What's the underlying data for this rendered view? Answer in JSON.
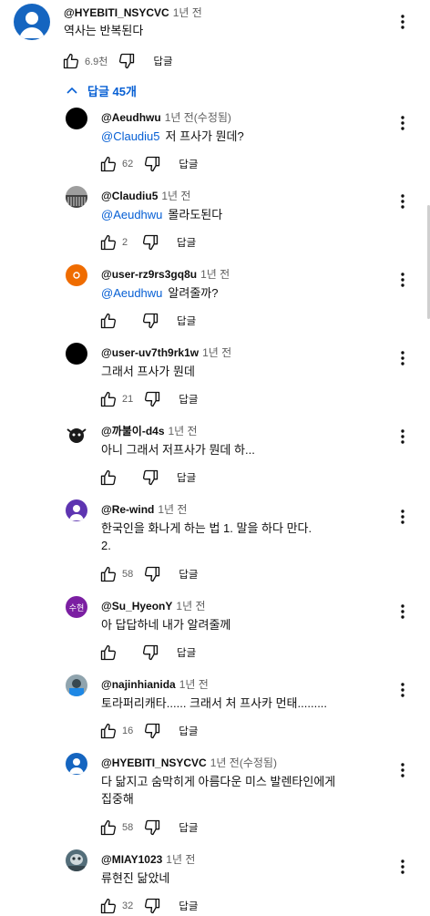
{
  "top_comment": {
    "author": "@HYEBITI_NSYCVC",
    "time": "1년 전",
    "text": "역사는 반복된다",
    "likes": "6.9천",
    "reply_label": "답글"
  },
  "replies_toggle": {
    "label": "답글 45개"
  },
  "replies": [
    {
      "author": "@Aeudhwu",
      "time": "1년 전(수정됨)",
      "mention": "@Claudiu5",
      "text": "저 프사가 뭔데?",
      "likes": "62",
      "reply_label": "답글"
    },
    {
      "author": "@Claudiu5",
      "time": "1년 전",
      "mention": "@Aeudhwu",
      "text": "몰라도된다",
      "likes": "2",
      "reply_label": "답글"
    },
    {
      "author": "@user-rz9rs3gq8u",
      "time": "1년 전",
      "mention": "@Aeudhwu",
      "text": "알려줄까?",
      "likes": "",
      "reply_label": "답글"
    },
    {
      "author": "@user-uv7th9rk1w",
      "time": "1년 전",
      "mention": "",
      "text": "그래서 프사가 뭔데",
      "likes": "21",
      "reply_label": "답글"
    },
    {
      "author": "@까불이-d4s",
      "time": "1년 전",
      "mention": "",
      "text": "아니 그래서 저프사가 뭔데 하...",
      "likes": "",
      "reply_label": "답글"
    },
    {
      "author": "@Re-wind",
      "time": "1년 전",
      "mention": "",
      "text": "한국인을 화나게 하는 법 1. 말을 하다 만다.",
      "text2": "2.",
      "likes": "58",
      "reply_label": "답글"
    },
    {
      "author": "@Su_HyeonY",
      "time": "1년 전",
      "mention": "",
      "text": "아 답답하네 내가 알려줄께",
      "likes": "",
      "reply_label": "답글",
      "avatar_text": "수현"
    },
    {
      "author": "@najinhianida",
      "time": "1년 전",
      "mention": "",
      "text": "토라퍼리캐타...... 크래서 처 프사카 먼태.........",
      "likes": "16",
      "reply_label": "답글"
    },
    {
      "author": "@HYEBITI_NSYCVC",
      "time": "1년 전(수정됨)",
      "mention": "",
      "text": "다 닮지고 숨막히게 아름다운 미스 발렌타인에게",
      "text2": "집중해",
      "likes": "58",
      "reply_label": "답글"
    },
    {
      "author": "@MIAY1023",
      "time": "1년 전",
      "mention": "",
      "text": "류현진 닮았네",
      "likes": "32",
      "reply_label": "답글"
    }
  ],
  "colors": {
    "link": "#065fd4",
    "muted": "#606060",
    "text": "#0f0f0f",
    "avatar_orange": "#ef6c00",
    "avatar_purple_rewind": "#5e35b1",
    "avatar_purple_su": "#7b1fa2"
  }
}
